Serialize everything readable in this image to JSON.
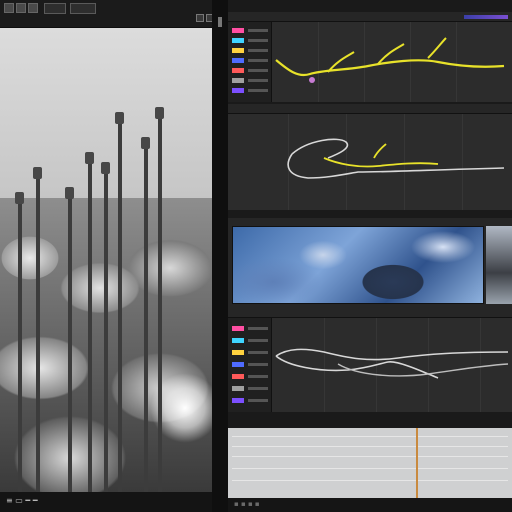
{
  "window": {
    "status_text": "≡ ▭ ━ ━"
  },
  "toolbar": {
    "icons": [
      "file-icon",
      "edit-icon",
      "view-icon"
    ],
    "field_value": "",
    "buttons": [
      "play-icon",
      "stop-icon"
    ]
  },
  "graph_editor": {
    "channels": [
      {
        "name": "",
        "color": "#ff4fa3"
      },
      {
        "name": "",
        "color": "#3fd4ff"
      },
      {
        "name": "",
        "color": "#ffd23f"
      },
      {
        "name": "",
        "color": "#4f6bff"
      },
      {
        "name": "",
        "color": "#ff5a5a"
      },
      {
        "name": "",
        "color": "#a0a0a0"
      },
      {
        "name": "",
        "color": "#7c4fff"
      }
    ],
    "curve_colors": [
      "#e8e22a",
      "#d8d8d8",
      "#c77bd3"
    ]
  },
  "footer": {
    "text": "▪ ▪ ▪ ▪"
  },
  "colors": {
    "accent": "#7a4fd1",
    "panel": "#2c2c2c",
    "timeline": "#cfd0d1"
  }
}
